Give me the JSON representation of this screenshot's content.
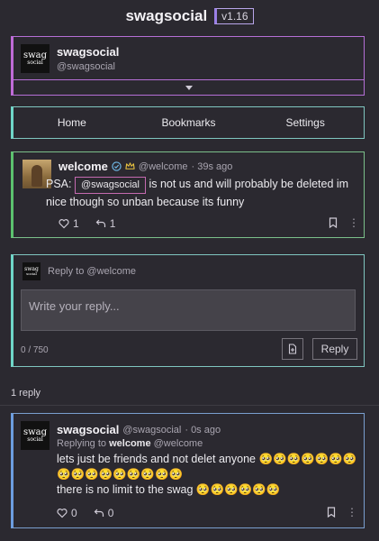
{
  "header": {
    "title": "swagsocial",
    "version": "v1.16"
  },
  "account": {
    "avatar_line1": "swag",
    "avatar_line2": "social",
    "name": "swagsocial",
    "handle": "@swagsocial"
  },
  "nav": {
    "items": [
      "Home",
      "Bookmarks",
      "Settings"
    ]
  },
  "post": {
    "author": "welcome",
    "handle": "@welcome",
    "time": "· 39s ago",
    "text_prefix": "PSA:",
    "mention": "@swagsocial",
    "text_suffix": "is not us and will probably be deleted im nice though so unban because its funny",
    "likes": "1",
    "reposts": "1"
  },
  "reply_form": {
    "avatar_line1": "swag",
    "avatar_line2": "social",
    "reply_to": "Reply to @welcome",
    "placeholder": "Write your reply...",
    "char_count": "0 / 750",
    "submit_label": "Reply"
  },
  "replies_label": "1 reply",
  "reply": {
    "avatar_line1": "swag",
    "avatar_line2": "social",
    "author": "swagsocial",
    "handle": "@swagsocial",
    "time": "· 0s ago",
    "replying_prefix": "Replying to",
    "replying_name": "welcome",
    "replying_handle": "@welcome",
    "line1": "lets just be friends and not delet anyone 🥺🥺🥺🥺🥺🥺🥺",
    "line2": "🥺🥺🥺🥺🥺🥺🥺🥺🥺",
    "line3": "there is no limit to the swag 🥺🥺🥺🥺🥺🥺",
    "likes": "0",
    "reposts": "0"
  },
  "colors": {
    "background": "#2b2930",
    "account_border": "#c06bd8",
    "nav_border": "#6fd6c8",
    "post_border": "#5cc26e",
    "reply_border": "#6c9de0",
    "mention_border": "#c46ab0",
    "version_border": "#9a7fe6"
  },
  "icons": [
    "caret-down-icon",
    "verified-icon",
    "crown-icon",
    "heart-icon",
    "repost-icon",
    "bookmark-icon",
    "more-icon",
    "attach-icon"
  ]
}
